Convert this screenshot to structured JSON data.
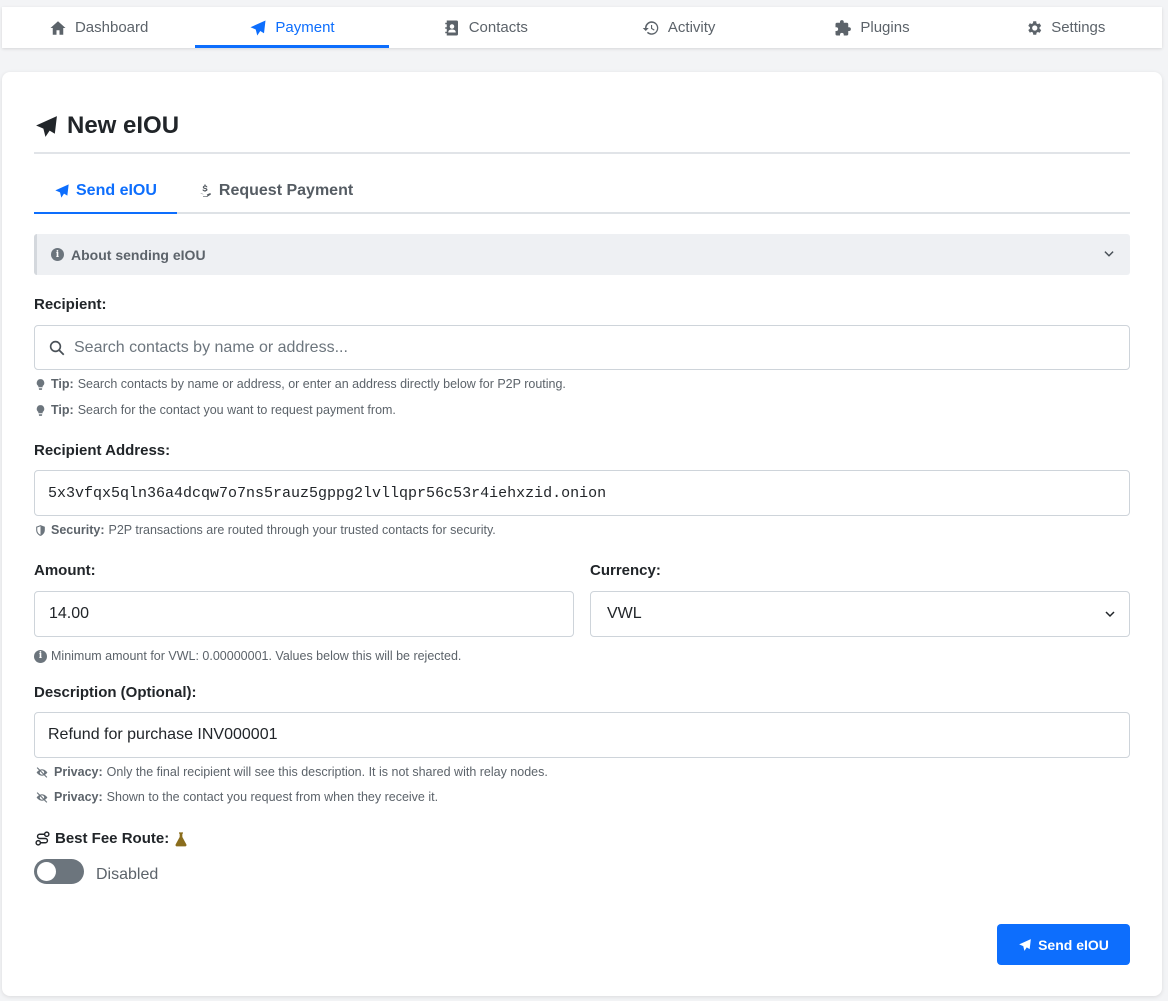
{
  "nav": {
    "tabs": [
      {
        "label": "Dashboard",
        "icon": "home-icon"
      },
      {
        "label": "Payment",
        "icon": "paper-plane-icon",
        "active": true
      },
      {
        "label": "Contacts",
        "icon": "address-book-icon"
      },
      {
        "label": "Activity",
        "icon": "history-icon"
      },
      {
        "label": "Plugins",
        "icon": "puzzle-icon"
      },
      {
        "label": "Settings",
        "icon": "gear-icon"
      }
    ]
  },
  "page": {
    "title": "New eIOU"
  },
  "subtabs": {
    "send_label": "Send eIOU",
    "request_label": "Request Payment",
    "active": "send"
  },
  "about": {
    "label": "About sending eIOU"
  },
  "recipient": {
    "label": "Recipient:",
    "search_placeholder": "Search contacts by name or address...",
    "tip_label": "Tip:",
    "tip1": "Search contacts by name or address, or enter an address directly below for P2P routing.",
    "tip2": "Search for the contact you want to request payment from."
  },
  "address": {
    "label": "Recipient Address:",
    "value": "5x3vfqx5qln36a4dcqw7o7ns5rauz5gppg2lvllqpr56c53r4iehxzid.onion",
    "security_label": "Security:",
    "security_text": "P2P transactions are routed through your trusted contacts for security."
  },
  "amount": {
    "label": "Amount:",
    "value": "14.00",
    "min_note": "Minimum amount for VWL: 0.00000001. Values below this will be rejected."
  },
  "currency": {
    "label": "Currency:",
    "value": "VWL"
  },
  "description": {
    "label": "Description (Optional):",
    "value": "Refund for purchase INV000001",
    "privacy_label": "Privacy:",
    "privacy1": "Only the final recipient will see this description. It is not shared with relay nodes.",
    "privacy2": "Shown to the contact you request from when they receive it."
  },
  "fee_route": {
    "label": "Best Fee Route:",
    "state_label": "Disabled",
    "enabled": false
  },
  "actions": {
    "send_label": "Send eIOU"
  },
  "colors": {
    "accent": "#0d6efd",
    "toggle_off": "#6c757d",
    "flask": "#8a6d1d"
  }
}
